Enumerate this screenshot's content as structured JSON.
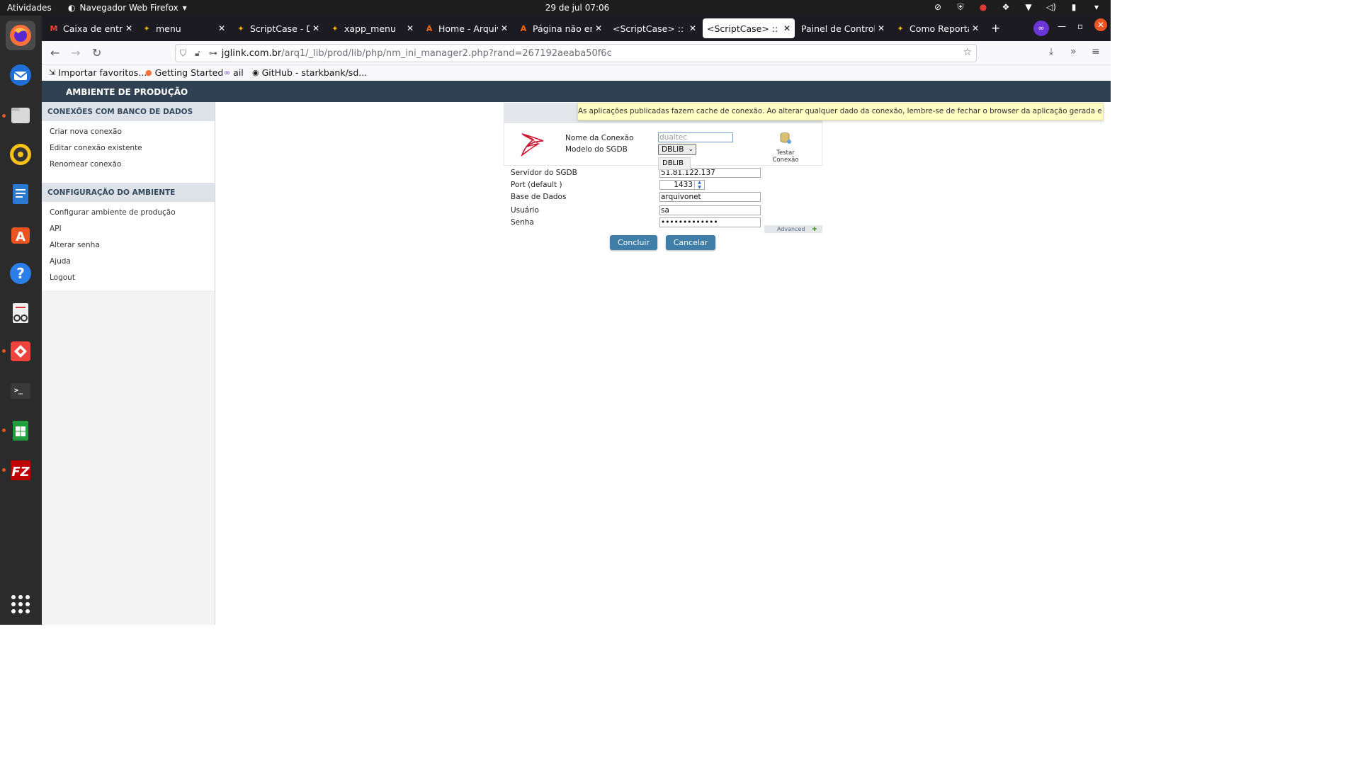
{
  "topbar": {
    "activities": "Atividades",
    "app_menu": "Navegador Web Firefox",
    "clock": "29 de jul  07:06"
  },
  "tabs": [
    {
      "label": "Caixa de entrada",
      "favicon": "gmail-icon",
      "close": "✕"
    },
    {
      "label": "menu",
      "favicon": "scriptcase-icon",
      "close": "✕"
    },
    {
      "label": "ScriptCase - Des",
      "favicon": "scriptcase-icon",
      "close": "✕"
    },
    {
      "label": "xapp_menu",
      "favicon": "scriptcase-icon",
      "close": "✕"
    },
    {
      "label": "Home - Arquivo",
      "favicon": "arquivo-icon",
      "close": "✕"
    },
    {
      "label": "Página não enco",
      "favicon": "arquivo-icon",
      "close": "✕"
    },
    {
      "label": "<ScriptCase> :: Am",
      "favicon": "",
      "close": "✕"
    },
    {
      "label": "<ScriptCase> :: Am",
      "favicon": "",
      "close": "✕"
    },
    {
      "label": "Painel de Controle",
      "favicon": "",
      "close": "✕"
    },
    {
      "label": "Como Reportar",
      "favicon": "scriptcase-icon",
      "close": "✕"
    }
  ],
  "url": {
    "host": "jglink.com.br",
    "path": "/arq1/_lib/prod/lib/php/nm_ini_manager2.php?rand=267192aeaba50f6c"
  },
  "bookmarks": [
    {
      "label": "Importar favoritos..."
    },
    {
      "label": "Getting Started"
    },
    {
      "label": "ail"
    },
    {
      "label": "GitHub - starkbank/sd..."
    }
  ],
  "app": {
    "header_title": "AMBIENTE DE PRODUÇÃO",
    "section1_title": "CONEXÕES COM BANCO DE DADOS",
    "section1_items": [
      "Criar nova conexão",
      "Editar conexão existente",
      "Renomear conexão"
    ],
    "section2_title": "CONFIGURAÇÃO DO AMBIENTE",
    "section2_items": [
      "Configurar ambiente de produção",
      "API",
      "Alterar senha",
      "Ajuda",
      "Logout"
    ],
    "notice": "As aplicações publicadas fazem cache de conexão. Ao alterar qualquer dado da conexão, lembre-se de fechar o browser da aplicação gerada e abrir novamente!"
  },
  "form": {
    "connection_name_label": "Nome da Conexão",
    "connection_name_placeholder": "dualtec",
    "sgdb_model_label": "Modelo do SGDB",
    "sgdb_model_value": "DBLIB",
    "dropdown_option": "DBLIB",
    "server_label": "Servidor do SGDB",
    "server_value": "51.81.122.137",
    "port_label": "Port (default )",
    "port_value": "1433",
    "database_label": "Base de Dados",
    "database_value": "arquivonet",
    "user_label": "Usuário",
    "user_value": "sa",
    "password_label": "Senha",
    "password_value": "•••••••••••••",
    "test_connection": "Testar Conexão",
    "advanced": "Advanced",
    "submit": "Concluir",
    "cancel": "Cancelar"
  }
}
